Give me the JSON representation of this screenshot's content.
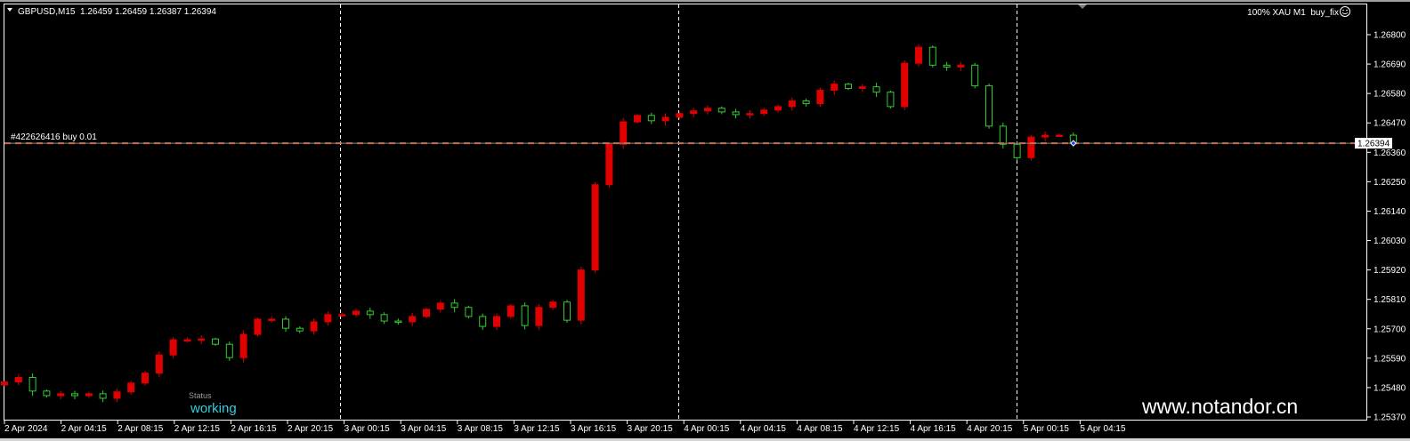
{
  "header": {
    "symbol_info": "GBPUSD,M15  1.26459 1.26459 1.26387 1.26394",
    "right_info": "100% XAU M1  buy_fix",
    "smiley_icon": "smiley-face-icon"
  },
  "order_line": {
    "label": "#422626416 buy 0.01",
    "price": 1.26394
  },
  "current_price_label": "1.26394",
  "status": {
    "title": "Status",
    "value": "working"
  },
  "watermark": "www.notandor.cn",
  "colors": {
    "background": "#000000",
    "bull_candle": "#e00000",
    "bear_candle": "#32cd32",
    "order_line": "#c0705a",
    "status_value": "#2fd0e0"
  },
  "chart_data": {
    "type": "candlestick",
    "title": "GBPUSD,M15",
    "ylim": [
      1.2537,
      1.268
    ],
    "y_ticks": [
      "1.26800",
      "1.26690",
      "1.26580",
      "1.26470",
      "1.26360",
      "1.26250",
      "1.26140",
      "1.26030",
      "1.25920",
      "1.25810",
      "1.25700",
      "1.25590",
      "1.25480",
      "1.25370"
    ],
    "x_ticks": [
      "2 Apr 2024",
      "2 Apr 04:15",
      "2 Apr 08:15",
      "2 Apr 12:15",
      "2 Apr 16:15",
      "2 Apr 20:15",
      "3 Apr 00:15",
      "3 Apr 04:15",
      "3 Apr 08:15",
      "3 Apr 12:15",
      "3 Apr 16:15",
      "3 Apr 20:15",
      "4 Apr 00:15",
      "4 Apr 04:15",
      "4 Apr 08:15",
      "4 Apr 12:15",
      "4 Apr 16:15",
      "4 Apr 20:15",
      "5 Apr 00:15",
      "5 Apr 04:15"
    ],
    "grid": false,
    "closes_hourly_approx": [
      1.25501,
      1.25518,
      1.25467,
      1.2545,
      1.25457,
      1.2545,
      1.25457,
      1.2544,
      1.25464,
      1.25497,
      1.25534,
      1.25602,
      1.25659,
      1.25659,
      1.25662,
      1.25642,
      1.25592,
      1.25679,
      1.25736,
      1.25736,
      1.25702,
      1.25692,
      1.25726,
      1.25753,
      1.25753,
      1.25766,
      1.25753,
      1.25729,
      1.25726,
      1.25746,
      1.25773,
      1.25796,
      1.2578,
      1.25746,
      1.25709,
      1.25746,
      1.25786,
      1.25712,
      1.2578,
      1.258,
      1.25732,
      1.2592,
      1.26239,
      1.2639,
      1.26474,
      1.26498,
      1.26478,
      1.26491,
      1.26505,
      1.26515,
      1.26525,
      1.26511,
      1.26501,
      1.26505,
      1.26518,
      1.26531,
      1.26552,
      1.26542,
      1.26592,
      1.26615,
      1.26599,
      1.26605,
      1.26585,
      1.26531,
      1.26693,
      1.26753,
      1.26686,
      1.26679,
      1.26686,
      1.26609,
      1.26458,
      1.2639,
      1.2634,
      1.26417,
      1.26424,
      1.26424,
      1.26394
    ],
    "first_open": 1.2549
  }
}
